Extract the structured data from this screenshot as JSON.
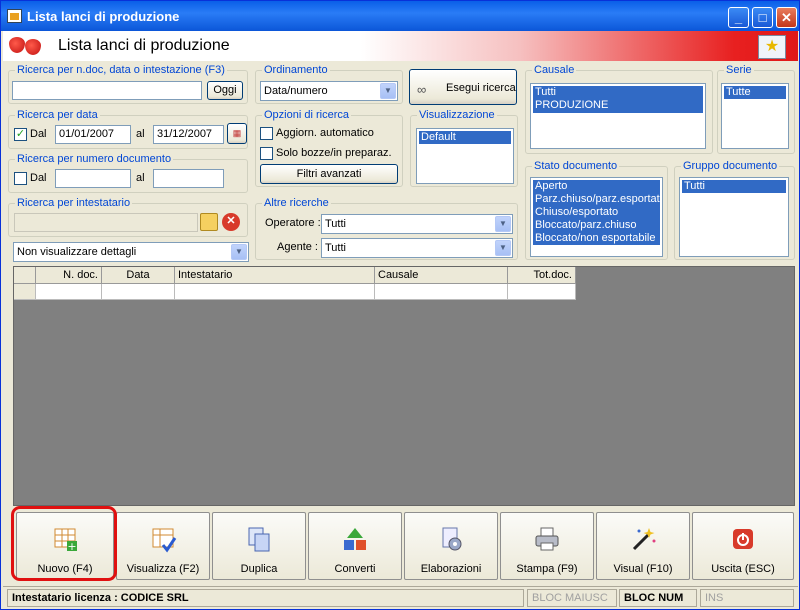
{
  "window": {
    "title": "Lista lanci di produzione",
    "min": "_",
    "max": "□",
    "close": "✕"
  },
  "header": {
    "title": "Lista lanci di produzione"
  },
  "search_doc": {
    "legend": "Ricerca per n.doc, data o intestazione (F3)",
    "value": "",
    "button": "Oggi"
  },
  "search_date": {
    "legend": "Ricerca per data",
    "dal_label": "Dal",
    "from": "01/01/2007",
    "al_label": "al",
    "to": "31/12/2007",
    "checked": "✓"
  },
  "search_num": {
    "legend": "Ricerca per numero documento",
    "dal_label": "Dal",
    "al_label": "al"
  },
  "search_owner": {
    "legend": "Ricerca per intestatario"
  },
  "details": {
    "selected": "Non visualizzare dettagli"
  },
  "ordering": {
    "legend": "Ordinamento",
    "selected": "Data/numero"
  },
  "execute": {
    "label": "Esegui ricerca"
  },
  "options": {
    "legend": "Opzioni di ricerca",
    "auto": "Aggiorn. automatico",
    "drafts": "Solo bozze/in preparaz.",
    "advanced": "Filtri avanzati"
  },
  "visual": {
    "legend": "Visualizzazione",
    "items": [
      "Default"
    ]
  },
  "other": {
    "legend": "Altre ricerche",
    "operator_label": "Operatore :",
    "operator": "Tutti",
    "agent_label": "Agente :",
    "agent": "Tutti"
  },
  "causale": {
    "legend": "Causale",
    "items": [
      "Tutti",
      "PRODUZIONE"
    ]
  },
  "serie": {
    "legend": "Serie",
    "items": [
      "Tutte"
    ]
  },
  "stato": {
    "legend": "Stato documento",
    "items": [
      "Aperto",
      "Parz.chiuso/parz.esportato",
      "Chiuso/esportato",
      "Bloccato/parz.chiuso",
      "Bloccato/non esportabile"
    ]
  },
  "gruppo": {
    "legend": "Gruppo documento",
    "items": [
      "Tutti"
    ]
  },
  "grid": {
    "columns": [
      "N. doc.",
      "Data",
      "Intestatario",
      "Causale",
      "Tot.doc."
    ]
  },
  "toolbar": {
    "buttons": [
      "Nuovo (F4)",
      "Visualizza (F2)",
      "Duplica",
      "Converti",
      "Elaborazioni",
      "Stampa (F9)",
      "Visual (F10)",
      "Uscita (ESC)"
    ]
  },
  "status": {
    "license": "Intestatario licenza : CODICE SRL",
    "caps": "BLOC MAIUSC",
    "num": "BLOC NUM",
    "ins": "INS"
  },
  "colors": {
    "selection": "#316ac5",
    "legend": "#0046d5",
    "highlight": "#e01010"
  }
}
